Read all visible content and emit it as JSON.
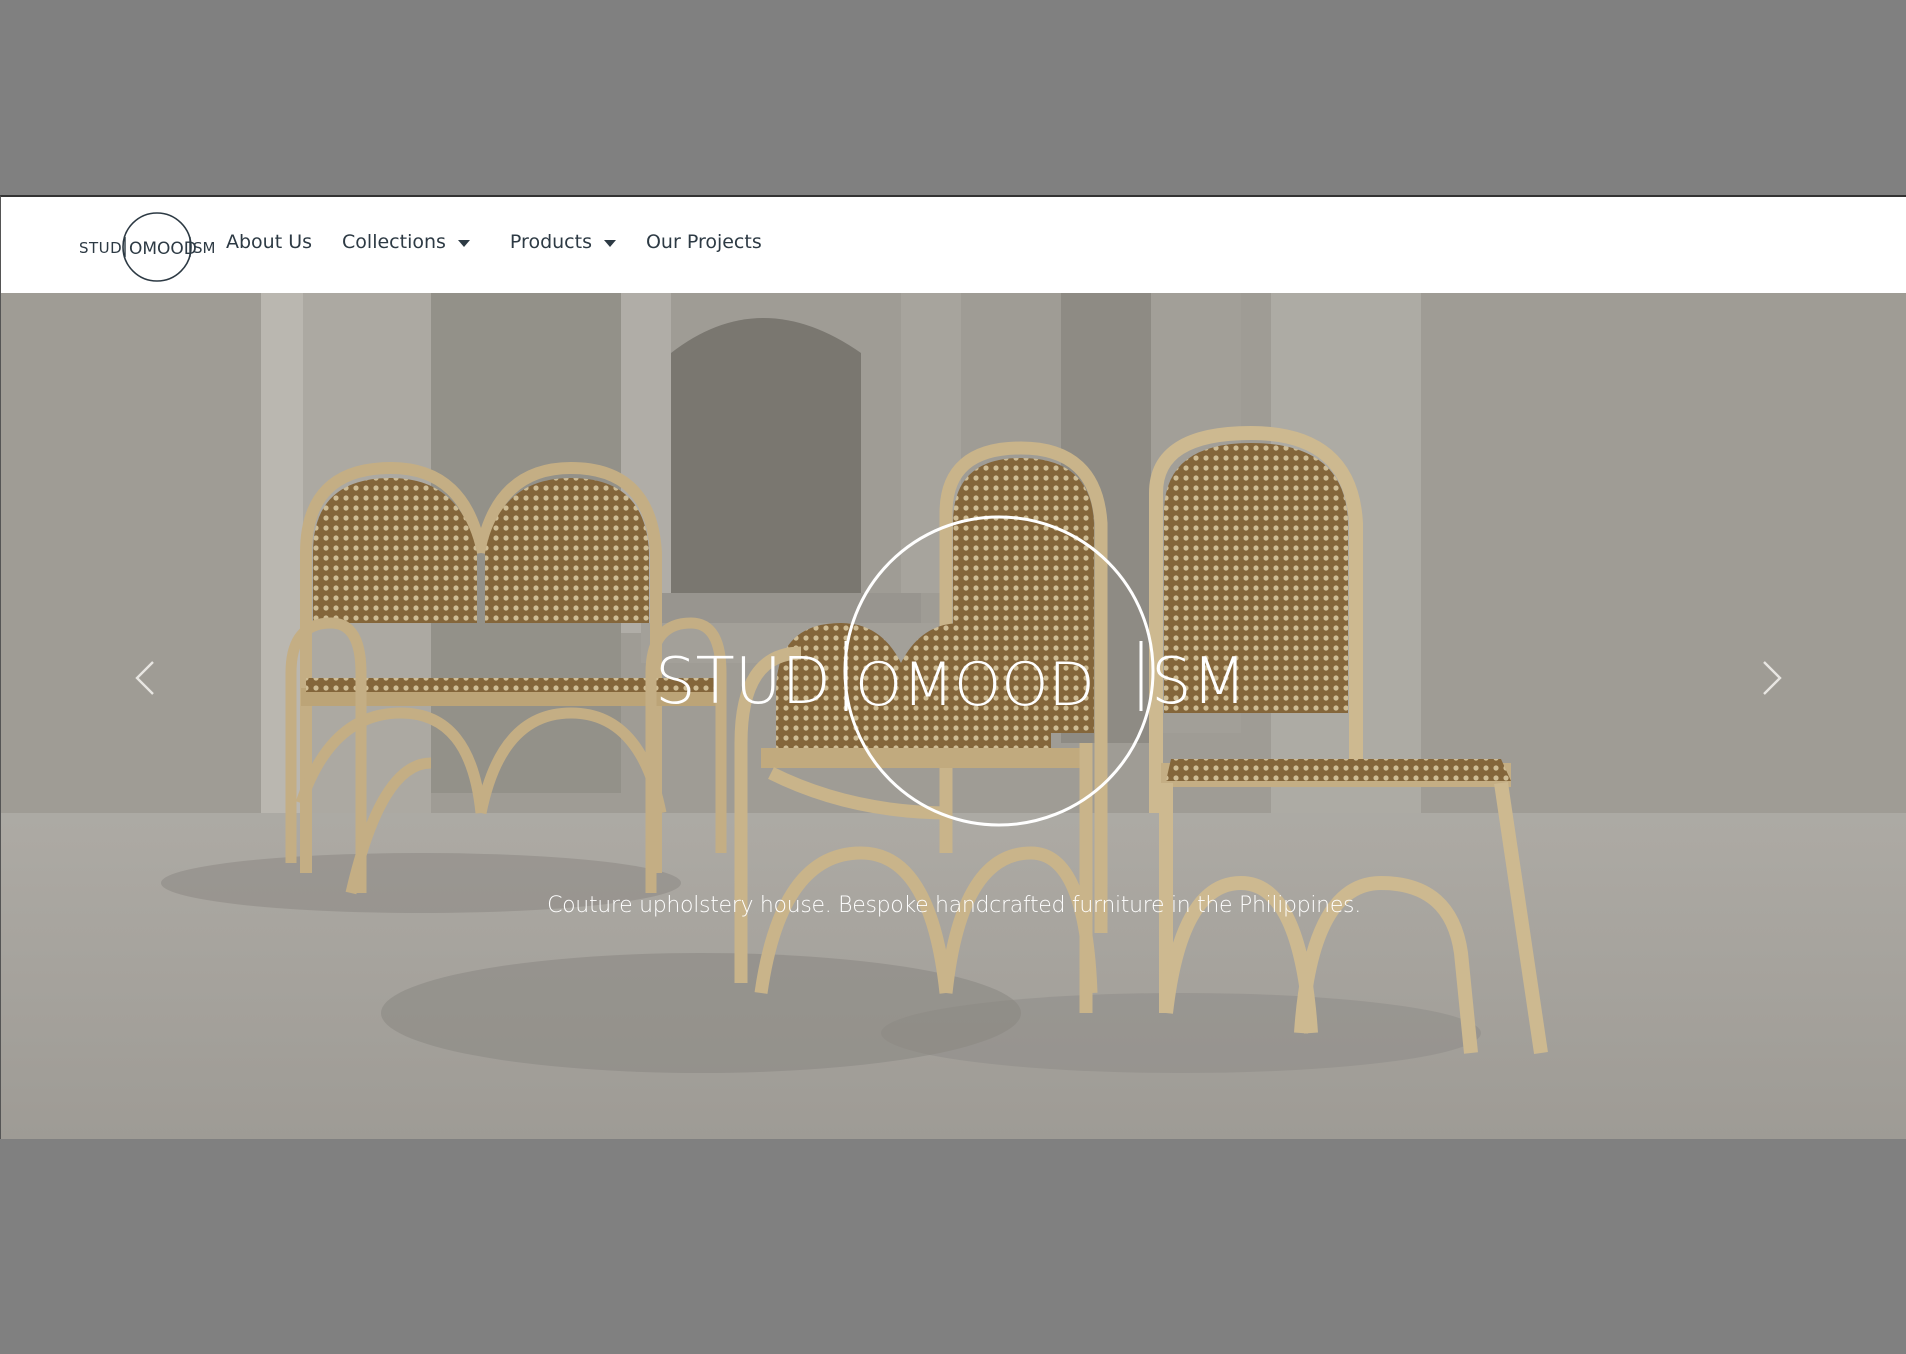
{
  "brand": {
    "name_left": "STUD",
    "name_middle": "OMOOD",
    "name_right": "SM"
  },
  "nav": {
    "items": [
      {
        "label": "About Us"
      },
      {
        "label": "Collections"
      },
      {
        "label": "Products"
      },
      {
        "label": "Our Projects"
      }
    ]
  },
  "hero": {
    "logo_left": "STUD",
    "logo_middle": "OMOOD",
    "logo_right": "SM",
    "tagline": "Couture upholstery house. Bespoke handcrafted furniture in the Philippines."
  },
  "controls": {
    "prev_icon": "chevron-left-icon",
    "next_icon": "chevron-right-icon"
  },
  "colors": {
    "backdrop": "#808080",
    "nav_text": "#2d3a44",
    "wall": "#a9a6a0",
    "rattan_wood": "#c9b48c",
    "cane": "#9c7a48",
    "hero_text": "#ffffff"
  }
}
